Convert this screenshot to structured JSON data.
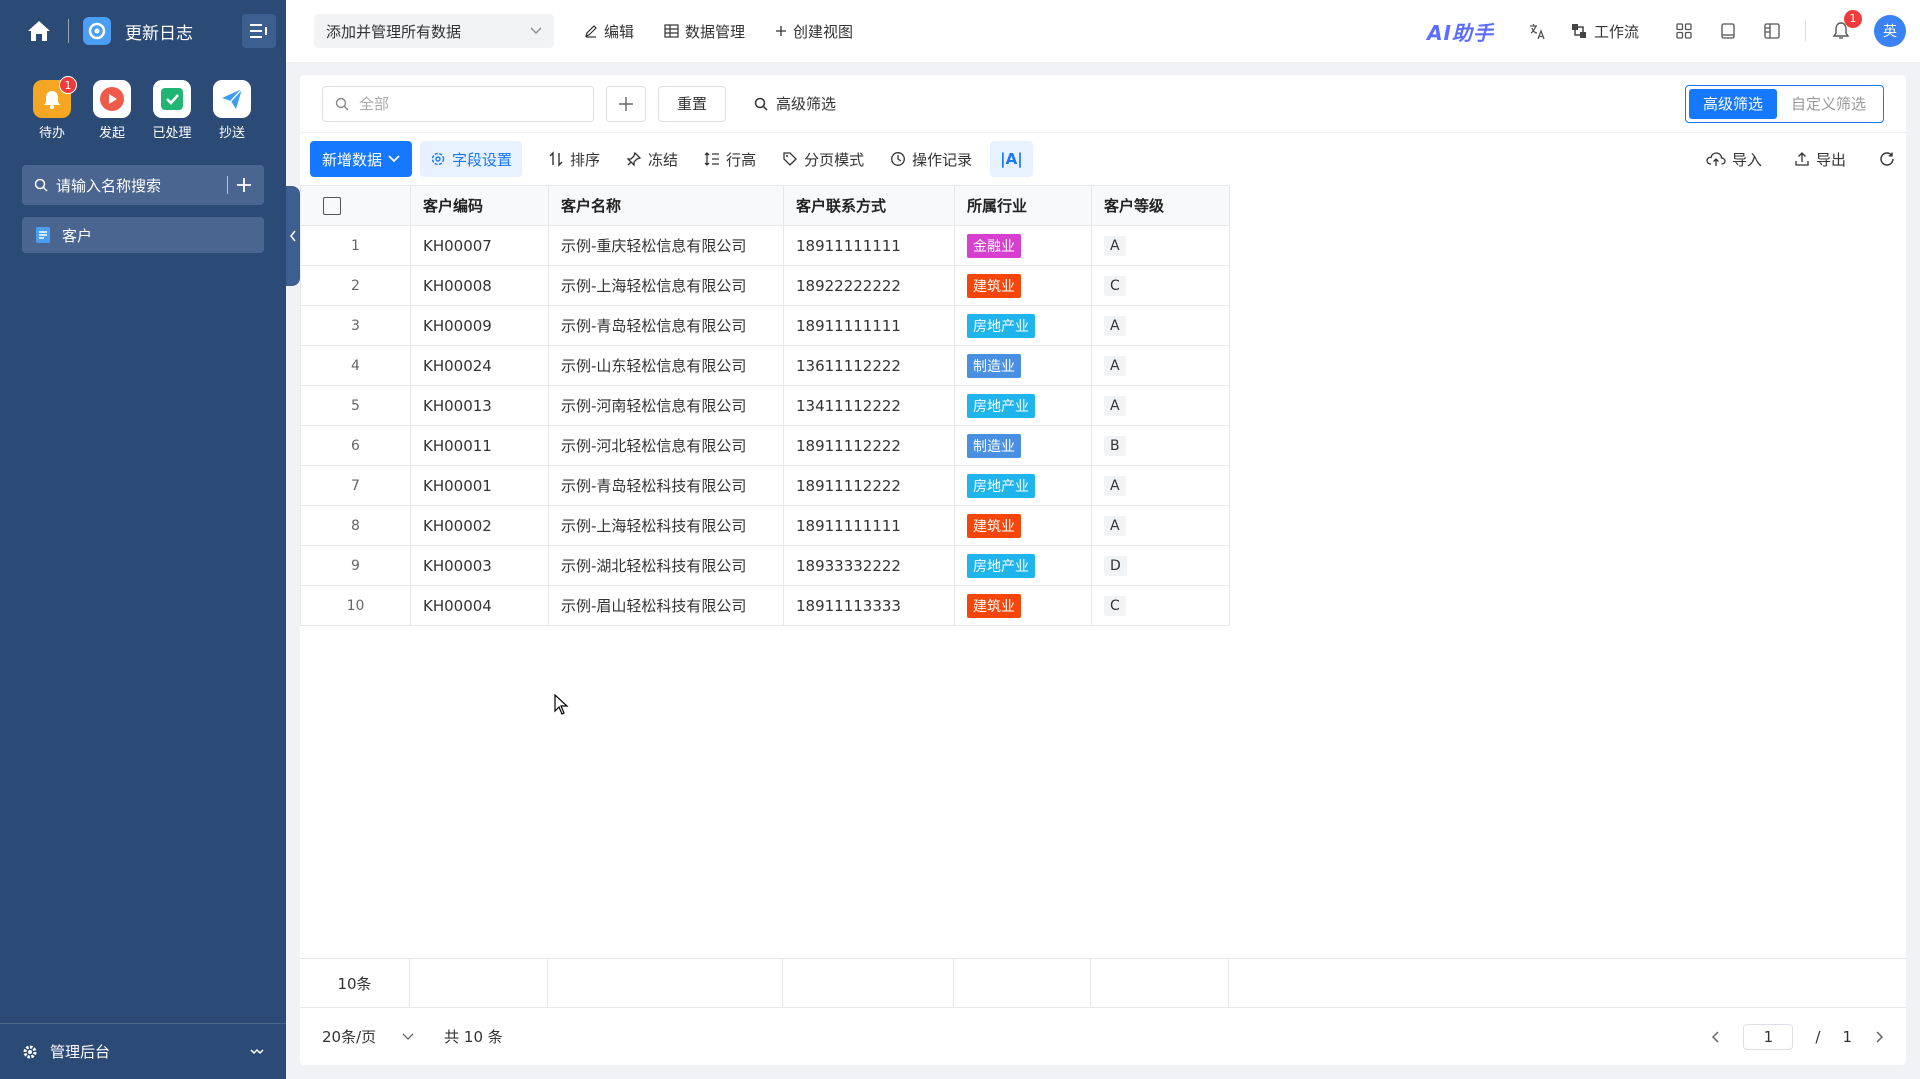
{
  "sidebar": {
    "title": "更新日志",
    "quick": [
      {
        "label": "待办",
        "badge": "1",
        "color": "#f5a623",
        "icon": "bell-icon"
      },
      {
        "label": "发起",
        "color": "#ee5b4b",
        "icon": "play-icon"
      },
      {
        "label": "已处理",
        "color": "#21b573",
        "icon": "check-icon"
      },
      {
        "label": "抄送",
        "color": "#3b9cf5",
        "icon": "send-icon"
      }
    ],
    "search_placeholder": "请输入名称搜索",
    "items": [
      {
        "label": "客户"
      }
    ],
    "footer_label": "管理后台"
  },
  "topbar": {
    "view_name": "添加并管理所有数据",
    "edit": "编辑",
    "data_manage": "数据管理",
    "create_view": "创建视图",
    "ai": "AI助手",
    "workflow": "工作流",
    "bell_badge": "1",
    "avatar": "英"
  },
  "filter": {
    "search_placeholder": "全部",
    "reset": "重置",
    "advanced": "高级筛选",
    "seg": [
      "高级筛选",
      "自定义筛选"
    ]
  },
  "toolbar": {
    "add": "新增数据",
    "field_settings": "字段设置",
    "sort": "排序",
    "freeze": "冻结",
    "row_height": "行高",
    "page_mode": "分页模式",
    "history": "操作记录",
    "font": "|A|",
    "import": "导入",
    "export": "导出"
  },
  "table": {
    "headers": [
      "客户编码",
      "客户名称",
      "客户联系方式",
      "所属行业",
      "客户等级"
    ],
    "rows": [
      {
        "idx": "1",
        "code": "KH00007",
        "name": "示例-重庆轻松信息有限公司",
        "phone": "18911111111",
        "industry": "金融业",
        "color": "#d63fcf",
        "level": "A"
      },
      {
        "idx": "2",
        "code": "KH00008",
        "name": "示例-上海轻松信息有限公司",
        "phone": "18922222222",
        "industry": "建筑业",
        "color": "#f5450a",
        "level": "C"
      },
      {
        "idx": "3",
        "code": "KH00009",
        "name": "示例-青岛轻松信息有限公司",
        "phone": "18911111111",
        "industry": "房地产业",
        "color": "#1fb5ec",
        "level": "A"
      },
      {
        "idx": "4",
        "code": "KH00024",
        "name": "示例-山东轻松信息有限公司",
        "phone": "13611112222",
        "industry": "制造业",
        "color": "#4a90e2",
        "level": "A"
      },
      {
        "idx": "5",
        "code": "KH00013",
        "name": "示例-河南轻松信息有限公司",
        "phone": "13411112222",
        "industry": "房地产业",
        "color": "#1fb5ec",
        "level": "A"
      },
      {
        "idx": "6",
        "code": "KH00011",
        "name": "示例-河北轻松信息有限公司",
        "phone": "18911112222",
        "industry": "制造业",
        "color": "#4a90e2",
        "level": "B"
      },
      {
        "idx": "7",
        "code": "KH00001",
        "name": "示例-青岛轻松科技有限公司",
        "phone": "18911112222",
        "industry": "房地产业",
        "color": "#1fb5ec",
        "level": "A"
      },
      {
        "idx": "8",
        "code": "KH00002",
        "name": "示例-上海轻松科技有限公司",
        "phone": "18911111111",
        "industry": "建筑业",
        "color": "#f5450a",
        "level": "A"
      },
      {
        "idx": "9",
        "code": "KH00003",
        "name": "示例-湖北轻松科技有限公司",
        "phone": "18933332222",
        "industry": "房地产业",
        "color": "#1fb5ec",
        "level": "D"
      },
      {
        "idx": "10",
        "code": "KH00004",
        "name": "示例-眉山轻松科技有限公司",
        "phone": "18911113333",
        "industry": "建筑业",
        "color": "#f5450a",
        "level": "C"
      }
    ],
    "summary": "10条"
  },
  "pager": {
    "page_size": "20条/页",
    "total": "共 10 条",
    "current": "1",
    "sep": "/",
    "pages": "1"
  }
}
